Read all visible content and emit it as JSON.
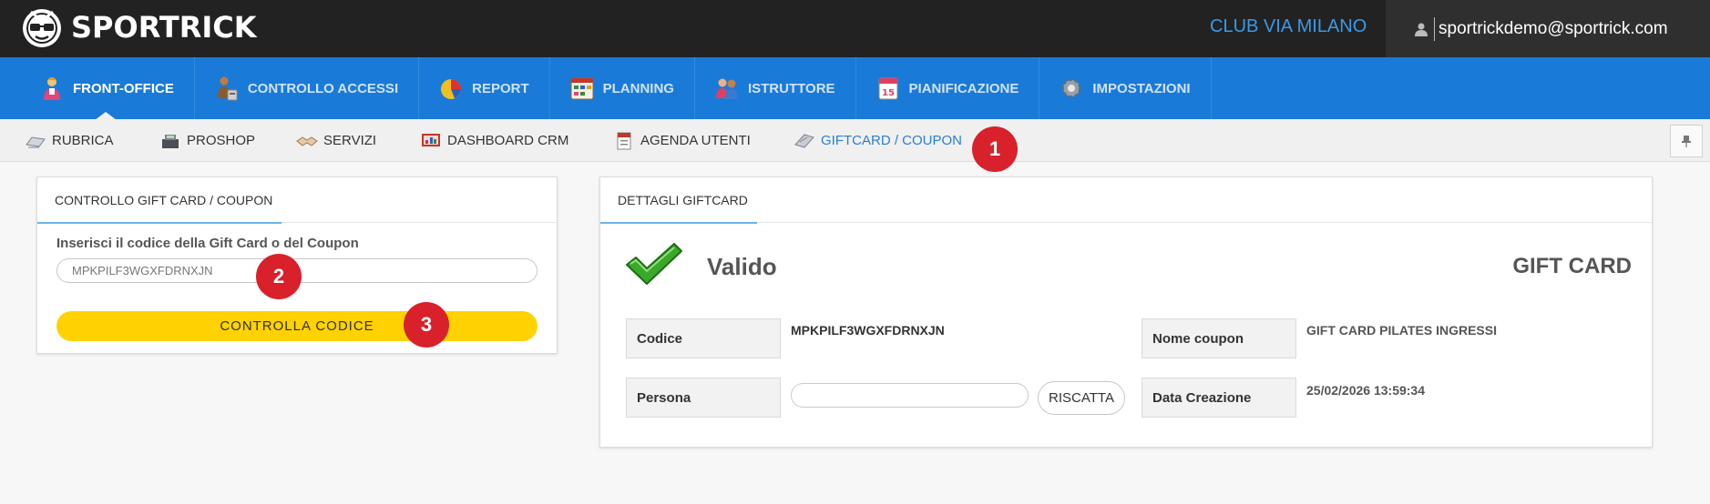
{
  "app": {
    "brand": "SPORTRICK",
    "club": "CLUB VIA MILANO",
    "user_email": "sportrickdemo@sportrick.com"
  },
  "main_nav": [
    {
      "label": "FRONT-OFFICE",
      "icon": "front-office-icon",
      "active": true
    },
    {
      "label": "CONTROLLO ACCESSI",
      "icon": "access-control-icon"
    },
    {
      "label": "REPORT",
      "icon": "pie-chart-icon"
    },
    {
      "label": "PLANNING",
      "icon": "calendar-grid-icon"
    },
    {
      "label": "ISTRUTTORE",
      "icon": "instructor-icon"
    },
    {
      "label": "PIANIFICAZIONE",
      "icon": "calendar-icon"
    },
    {
      "label": "IMPOSTAZIONI",
      "icon": "gear-icon"
    }
  ],
  "sub_nav": [
    {
      "label": "RUBRICA",
      "icon": "address-book-icon"
    },
    {
      "label": "PROSHOP",
      "icon": "cash-register-icon"
    },
    {
      "label": "SERVIZI",
      "icon": "handshake-icon"
    },
    {
      "label": "DASHBOARD CRM",
      "icon": "dashboard-icon"
    },
    {
      "label": "AGENDA UTENTI",
      "icon": "agenda-icon"
    },
    {
      "label": "GIFTCARD / COUPON",
      "icon": "giftcard-icon",
      "active": true
    }
  ],
  "badges": [
    "1",
    "2",
    "3"
  ],
  "check_panel": {
    "title": "CONTROLLO GIFT CARD / COUPON",
    "input_label": "Inserisci il codice della Gift Card o del Coupon",
    "code_value": "MPKPILF3WGXFDRNXJN",
    "button_label": "CONTROLLA CODICE"
  },
  "details_panel": {
    "title": "DETTAGLI GIFTCARD",
    "status": "Valido",
    "type": "GIFT CARD",
    "code_label": "Codice",
    "code_value": "MPKPILF3WGXFDRNXJN",
    "coupon_name_label": "Nome coupon",
    "coupon_name_value": "GIFT CARD PILATES INGRESSI",
    "person_label": "Persona",
    "person_value": "",
    "redeem_label": "RISCATTA",
    "created_label": "Data Creazione",
    "created_value": "25/02/2026 13:59:34"
  },
  "colors": {
    "topbar": "#222222",
    "nav_blue": "#1a7ad8",
    "accent_blue": "#3a9ae8",
    "button_yellow": "#ffd200",
    "badge_red": "#d8212b"
  }
}
